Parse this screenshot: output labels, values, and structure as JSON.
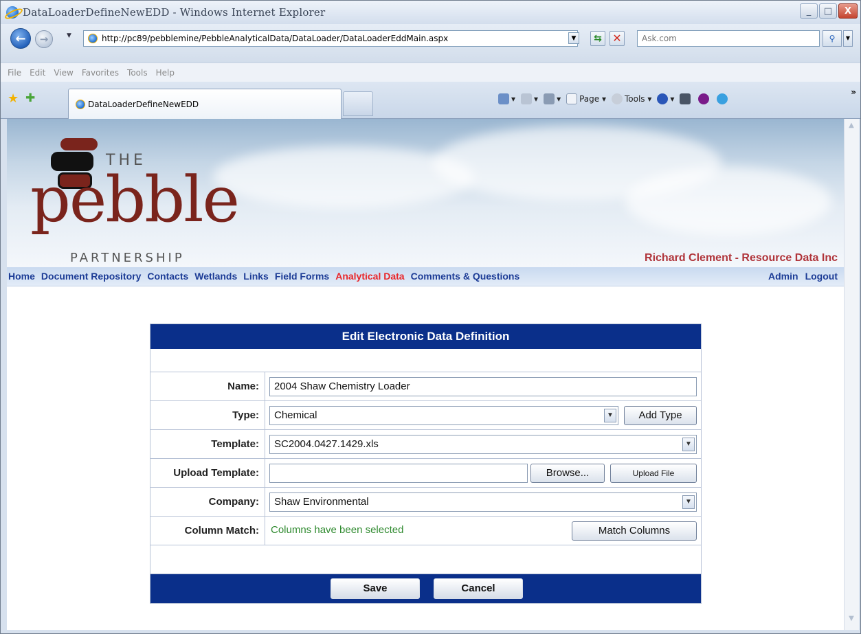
{
  "window": {
    "title": "DataLoaderDefineNewEDD - Windows Internet Explorer",
    "minimize_glyph": "_",
    "maximize_glyph": "□",
    "close_glyph": "X"
  },
  "address_bar": {
    "url": "http://pc89/pebblemine/PebbleAnalyticalData/DataLoader/DataLoaderEddMain.aspx",
    "search_placeholder": "Ask.com"
  },
  "menu": {
    "items": [
      "File",
      "Edit",
      "View",
      "Favorites",
      "Tools",
      "Help"
    ]
  },
  "tabs": {
    "active_label": "DataLoaderDefineNewEDD"
  },
  "command_bar": {
    "page_label": "Page",
    "tools_label": "Tools"
  },
  "site": {
    "logo": {
      "the": "THE",
      "pebble": "pebble",
      "partnership": "PARTNERSHIP"
    },
    "user_line": "Richard Clement - Resource Data Inc",
    "nav_left": [
      "Home",
      "Document Repository",
      "Contacts",
      "Wetlands",
      "Links",
      "Field Forms",
      "Analytical Data",
      "Comments & Questions"
    ],
    "nav_active": "Analytical Data",
    "nav_right": [
      "Admin",
      "Logout"
    ]
  },
  "form": {
    "title": "Edit Electronic Data Definition",
    "name_label": "Name:",
    "name_value": "2004 Shaw Chemistry Loader",
    "type_label": "Type:",
    "type_value": "Chemical",
    "add_type_button": "Add Type",
    "template_label": "Template:",
    "template_value": "SC2004.0427.1429.xls",
    "upload_label": "Upload Template:",
    "upload_value": "",
    "browse_button": "Browse...",
    "upload_file_button": "Upload File",
    "company_label": "Company:",
    "company_value": "Shaw Environmental",
    "column_match_label": "Column Match:",
    "column_match_status": "Columns have been selected",
    "match_columns_button": "Match Columns",
    "save_button": "Save",
    "cancel_button": "Cancel"
  },
  "colors": {
    "form_header": "#0a2f8a",
    "nav_link": "#1c3c96",
    "nav_active": "#e8272b",
    "user_line": "#b0343a",
    "status_text": "#2f8a2f",
    "logo_red": "#7a241c"
  }
}
